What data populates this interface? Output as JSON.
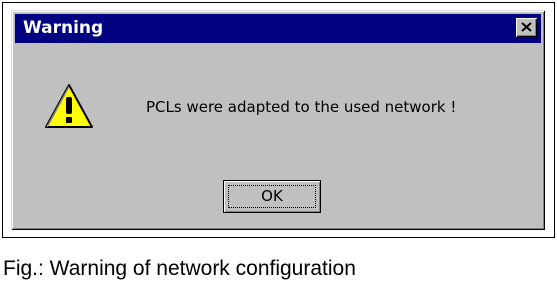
{
  "dialog": {
    "title": "Warning",
    "close_icon": "close-icon",
    "warning_icon": "warning-triangle-icon",
    "message": "PCLs were adapted to the used network !",
    "ok_label": "OK"
  },
  "caption": "Fig.: Warning of network configuration",
  "colors": {
    "titlebar": "#000080",
    "dialog_face": "#c0c0c0",
    "warning_yellow": "#ffff00"
  }
}
